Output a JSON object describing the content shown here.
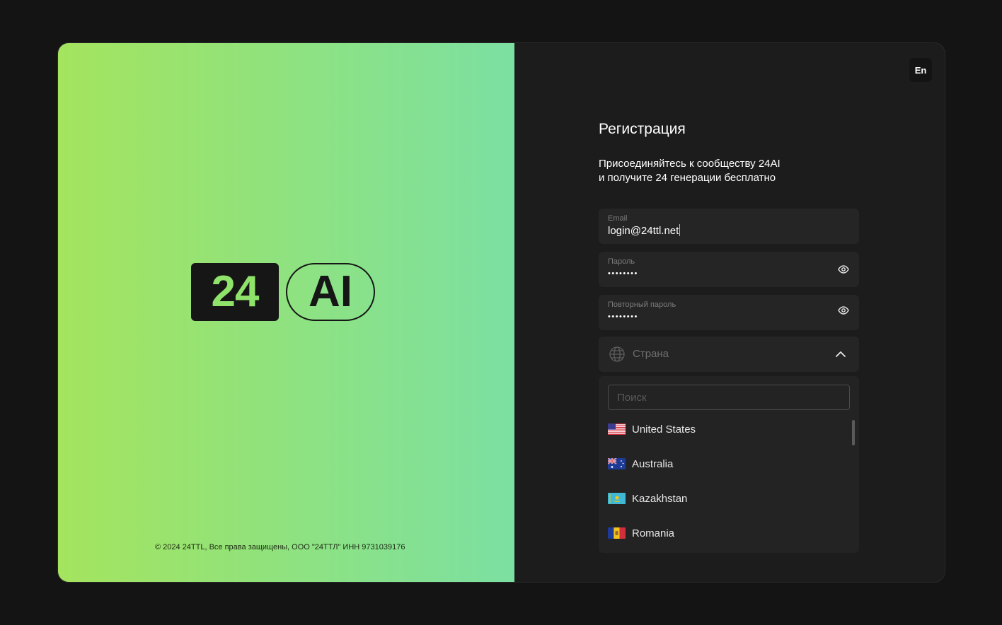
{
  "brand": {
    "logo_number": "24",
    "logo_text": "AI",
    "accent_color": "#8fe26a",
    "copyright": "© 2024 24TTL, Все права защищены, ООО \"24ТТЛ\" ИНН 9731039176"
  },
  "lang_switch": {
    "label": "En"
  },
  "form": {
    "title": "Регистрация",
    "subtitle_line1": "Присоединяйтесь к сообществу 24AI",
    "subtitle_line2": "и получите 24 генерации бесплатно",
    "email": {
      "label": "Email",
      "value": "login@24ttl.net"
    },
    "password": {
      "label": "Пароль",
      "value": "••••••••",
      "toggle_icon": "eye-icon"
    },
    "password_repeat": {
      "label": "Повторный пароль",
      "value": "••••••••",
      "toggle_icon": "eye-icon"
    },
    "country": {
      "placeholder": "Страна",
      "icon": "globe-icon",
      "search_placeholder": "Поиск",
      "options": [
        {
          "name": "United States",
          "flag": "us-flag-icon"
        },
        {
          "name": "Australia",
          "flag": "australia-flag-icon"
        },
        {
          "name": "Kazakhstan",
          "flag": "kazakhstan-flag-icon"
        },
        {
          "name": "Romania",
          "flag": "romania-flag-icon"
        }
      ]
    }
  }
}
